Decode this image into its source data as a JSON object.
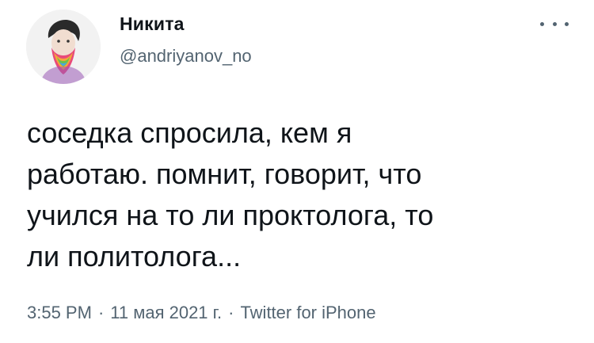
{
  "tweet": {
    "author": {
      "display_name": "Никита",
      "username": "@andriyanov_no",
      "avatar_icon": "bearded-man-avatar-icon"
    },
    "more_icon": "more-dots-icon",
    "text": "соседка спросила, кем я\nработаю. помнит, говорит, что\nучился на то ли проктолога, то\nли политолога...",
    "meta": {
      "time": "3:55 PM",
      "separator": "·",
      "date": "11 мая 2021 г.",
      "source": "Twitter for iPhone"
    }
  },
  "colors": {
    "text": "#0f1419",
    "secondary": "#536471",
    "background": "#ffffff"
  }
}
